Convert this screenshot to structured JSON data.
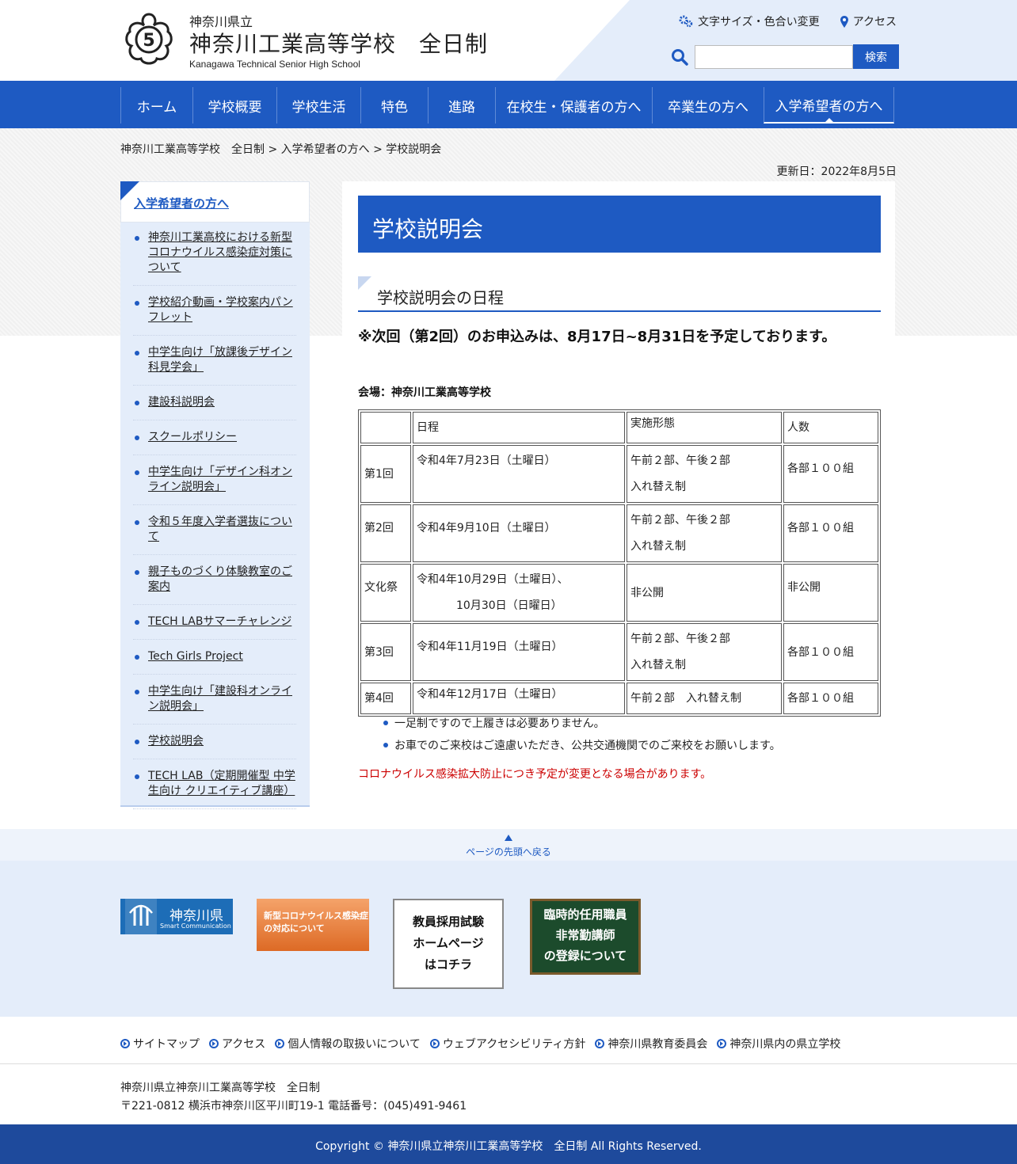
{
  "header": {
    "prefecture": "神奈川県立",
    "school_name": "神奈川工業高等学校　全日制",
    "school_name_en": "Kanagawa Technical Senior High School",
    "tools": [
      "文字サイズ・色合い変更",
      "アクセス"
    ],
    "search_button": "検索"
  },
  "nav": [
    "ホーム",
    "学校概要",
    "学校生活",
    "特色",
    "進路",
    "在校生・保護者の方へ",
    "卒業生の方へ",
    "入学希望者の方へ"
  ],
  "breadcrumb": "神奈川工業高等学校　全日制 > 入学希望者の方へ > 学校説明会",
  "updated": "更新日：2022年8月5日",
  "sidebar": {
    "heading": "入学希望者の方へ",
    "items": [
      "神奈川工業高校における新型コロナウイルス感染症対策について",
      "学校紹介動画・学校案内パンフレット",
      "中学生向け「放課後デザイン科見学会」",
      "建設科説明会",
      "スクールポリシー",
      "中学生向け「デザイン科オンライン説明会」",
      "令和５年度入学者選抜について",
      "親子ものづくり体験教室のご案内",
      "TECH LABサマーチャレンジ",
      "Tech Girls Project",
      "中学生向け「建設科オンライン説明会」",
      "学校説明会",
      "TECH LAB（定期開催型 中学生向け クリエイティブ講座）"
    ]
  },
  "main": {
    "title": "学校説明会",
    "subtitle": "学校説明会の日程",
    "notice": "※次回（第2回）のお申込みは、8月17日~8月31日を予定しております。",
    "venue": "会場：神奈川工業高等学校",
    "table": {
      "headers": [
        "",
        "日程",
        "実施形態",
        "人数"
      ],
      "rows": [
        [
          "第1回",
          "令和4年7月23日（土曜日）",
          "午前２部、午後２部",
          "入れ替え制",
          "各部１００組"
        ],
        [
          "第2回",
          "令和4年9月10日（土曜日）",
          "午前２部、午後２部",
          "入れ替え制",
          "各部１００組"
        ],
        [
          "文化祭",
          "令和4年10月29日（土曜日）、",
          "10月30日（日曜日）",
          "非公開",
          "非公開"
        ],
        [
          "第3回",
          "令和4年11月19日（土曜日）",
          "午前２部、午後２部",
          "入れ替え制",
          "各部１００組"
        ],
        [
          "第4回",
          "令和4年12月17日（土曜日）",
          "午前２部　入れ替え制",
          "各部１００組"
        ]
      ]
    },
    "bullets": [
      "一足制ですので上履きは必要ありません。",
      "お車でのご来校はご遠慮いただき、公共交通機関でのご来校をお願いします。"
    ],
    "warning": "コロナウイルス感染拡大防止につき予定が変更となる場合があります。"
  },
  "page_top": "ページの先頭へ戻る",
  "banners": {
    "kanagawa": "神奈川県",
    "kanagawa_sub": "Smart Communication",
    "corona": "新型コロナウイルス感染症の対応について",
    "teacher": [
      "教員採用試験",
      "ホームページ",
      "はコチラ"
    ],
    "temp": [
      "臨時的任用職員",
      "非常勤講師",
      "の登録について"
    ]
  },
  "footer_links": [
    "サイトマップ",
    "アクセス",
    "個人情報の取扱いについて",
    "ウェブアクセシビリティ方針",
    "神奈川県教育委員会",
    "神奈川県内の県立学校"
  ],
  "address": {
    "line1": "神奈川県立神奈川工業高等学校　全日制",
    "line2": "〒221-0812 横浜市神奈川区平川町19-1 電話番号：(045)491-9461"
  },
  "copyright": "Copyright © 神奈川県立神奈川工業高等学校　全日制 All Rights Reserved.",
  "colors": {
    "primary": "#1e5ac2",
    "light": "#e4edfa",
    "warning": "#cc0000"
  }
}
